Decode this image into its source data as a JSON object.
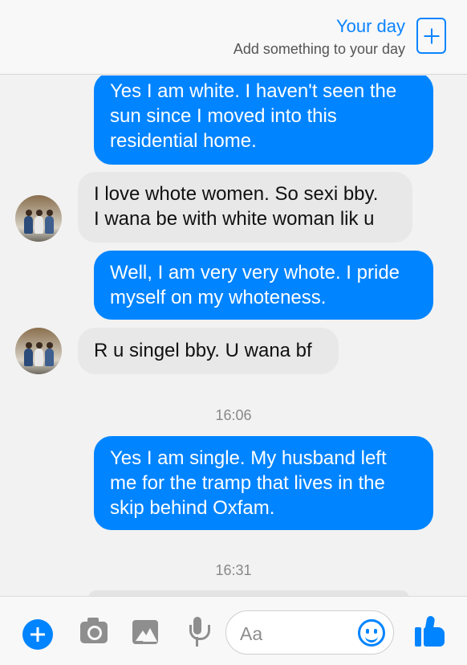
{
  "your_day": {
    "title": "Your day",
    "subtitle": "Add something to your day",
    "add_icon": "plus-square-icon"
  },
  "messages": [
    {
      "sender": "me",
      "lines": [
        "Yes I am white. I haven't seen the",
        "sun since I moved into this",
        "residential home."
      ]
    },
    {
      "sender": "them",
      "lines": [
        "I love whote women. So sexi bby.",
        "I wana be with white woman lik u"
      ]
    },
    {
      "sender": "me",
      "lines": [
        "Well, I am very very whote. I pride",
        "myself on my whoteness."
      ]
    },
    {
      "sender": "them",
      "lines": [
        "R u singel bby. U wana bf"
      ]
    },
    {
      "sender": "me",
      "lines": [
        "Yes I am single. My husband left",
        "me for the tramp that lives in the",
        "skip behind Oxfam."
      ]
    }
  ],
  "timestamps": [
    "16:06",
    "16:31"
  ],
  "composer": {
    "placeholder": "Aa",
    "icons": [
      "plus-icon",
      "camera-icon",
      "image-icon",
      "microphone-icon",
      "emoji-icon",
      "like-icon"
    ]
  },
  "colors": {
    "accent": "#0084ff",
    "outgoing_bubble": "#0084ff",
    "incoming_bubble": "#e8e8e8"
  }
}
